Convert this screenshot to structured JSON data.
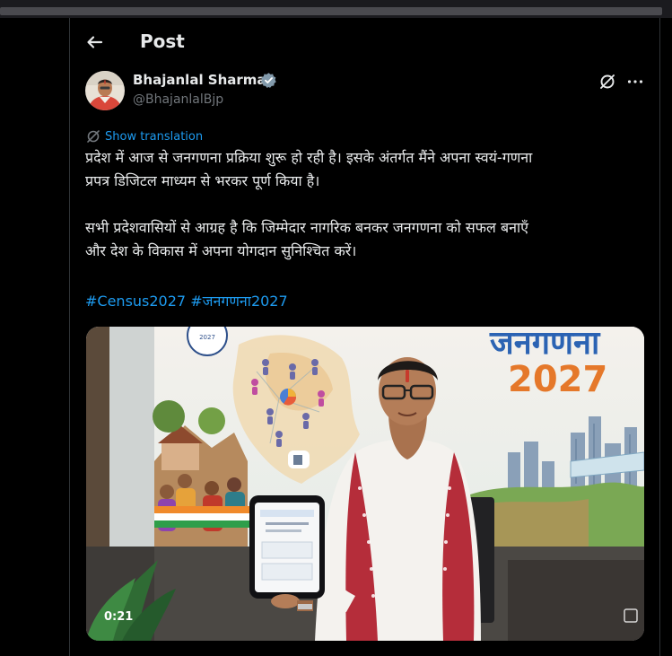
{
  "header": {
    "title": "Post"
  },
  "post": {
    "author_name": "Bhajanlal Sharma",
    "author_handle": "@BhajanlalBjp",
    "show_translation": "Show translation",
    "paragraph1_line1": "प्रदेश में आज से जनगणना प्रक्रिया शुरू हो रही है। इसके अंतर्गत मैंने अपना स्वयं-गणना",
    "paragraph1_line2": "प्रपत्र डिजिटल माध्यम से भरकर पूर्ण किया है।",
    "paragraph2_line1": "सभी प्रदेशवासियों से आग्रह है कि जिम्मेदार नागरिक बनकर जनगणना को सफल बनाएँ",
    "paragraph2_line2": "और देश के विकास में अपना योगदान सुनिश्चित करें।",
    "hashtag1": "#Census2027",
    "hashtag2": "#जनगणना2027"
  },
  "media": {
    "banner_title": "जनगणना",
    "banner_year": "2027",
    "seal_year": "2027",
    "duration": "0:21"
  },
  "colors": {
    "background": "#000000",
    "text": "#e7e9ea",
    "secondary_text": "#71767b",
    "link": "#1d9bf0",
    "verified": "#829aab"
  },
  "icons": {
    "back": "arrow-left-icon",
    "verified": "verified-badge-icon",
    "grok": "grok-icon",
    "more": "more-horizontal-icon",
    "translate": "translate-icon"
  }
}
